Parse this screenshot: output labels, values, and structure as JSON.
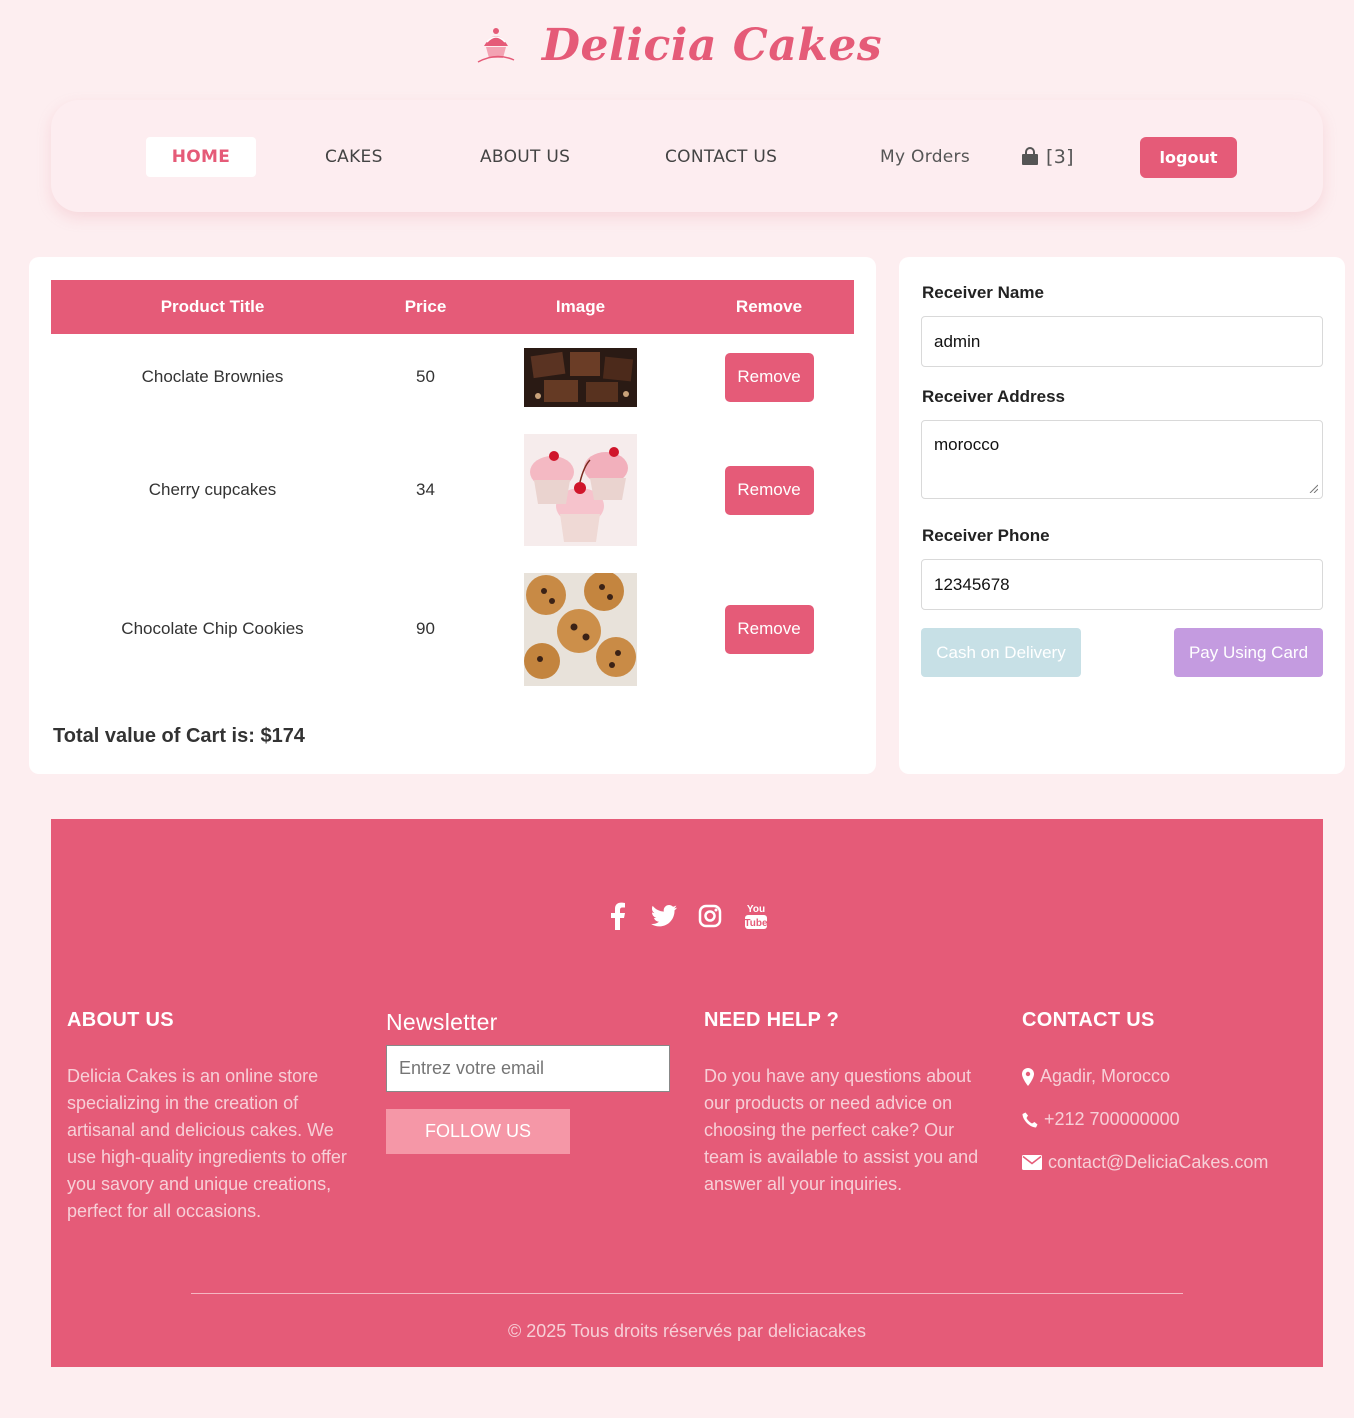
{
  "brand": {
    "name": "Delicia Cakes",
    "logo_icon": "cupcake-logo-icon",
    "color": "#e55b78"
  },
  "nav": {
    "home": "HOME",
    "cakes": "CAKES",
    "about": "ABOUT US",
    "contact": "CONTACT US",
    "orders": "My Orders",
    "cart_count": "[3]",
    "logout": "logout"
  },
  "cart": {
    "headers": [
      "Product Title",
      "Price",
      "Image",
      "Remove"
    ],
    "items": [
      {
        "title": "Choclate Brownies",
        "price": "50",
        "image": "brownies-image",
        "remove": "Remove"
      },
      {
        "title": "Cherry cupcakes",
        "price": "34",
        "image": "cupcakes-image",
        "remove": "Remove"
      },
      {
        "title": "Chocolate Chip Cookies",
        "price": "90",
        "image": "cookies-image",
        "remove": "Remove"
      }
    ],
    "total_text": "Total value of Cart is: $174"
  },
  "order_form": {
    "name_label": "Receiver Name",
    "name_value": "admin",
    "address_label": "Receiver Address",
    "address_value": "morocco",
    "phone_label": "Receiver Phone",
    "phone_value": "12345678",
    "cod_button": "Cash on Delivery",
    "card_button": "Pay Using Card"
  },
  "footer": {
    "socials": [
      "facebook-icon",
      "twitter-icon",
      "instagram-icon",
      "youtube-icon"
    ],
    "about_title": "ABOUT US",
    "about_text": "Delicia Cakes is an online store specializing in the creation of artisanal and delicious cakes. We use high-quality ingredients to offer you savory and unique creations, perfect for all occasions.",
    "newsletter_title": "Newsletter",
    "newsletter_placeholder": "Entrez votre email",
    "newsletter_button": "FOLLOW US",
    "help_title": "NEED HELP ?",
    "help_text": "Do you have any questions about our products or need advice on choosing the perfect cake? Our team is available to assist you and answer all your inquiries.",
    "contact_title": "CONTACT US",
    "location": "Agadir, Morocco",
    "phone": "+212 700000000",
    "email": "contact@DeliciaCakes.com",
    "copyright": "© 2025 Tous droits réservés par deliciacakes"
  }
}
